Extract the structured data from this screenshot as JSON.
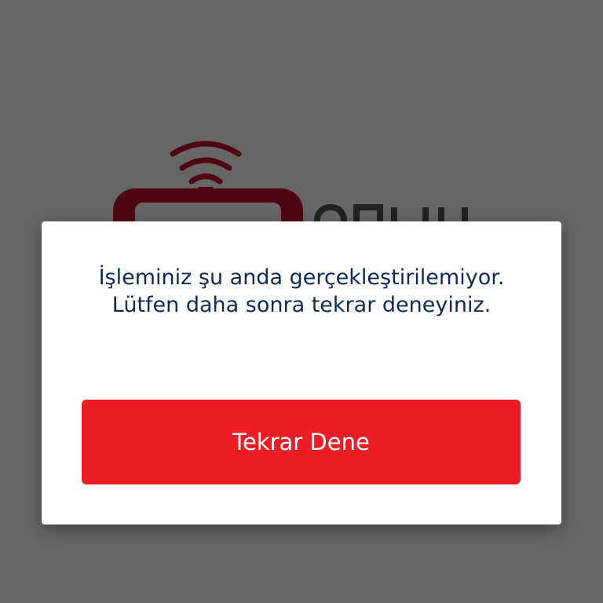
{
  "dialog": {
    "message": "İşleminiz şu anda gerçekleştirilemiyor. Lütfen daha sonra tekrar deneyiniz.",
    "retry_label": "Tekrar Dene"
  },
  "colors": {
    "overlay": "#666666",
    "button": "#ee1c25",
    "message_text": "#0e2a52",
    "logo_red": "#c8102e"
  },
  "icons": {
    "logo": "signal-waves-logo-icon"
  }
}
